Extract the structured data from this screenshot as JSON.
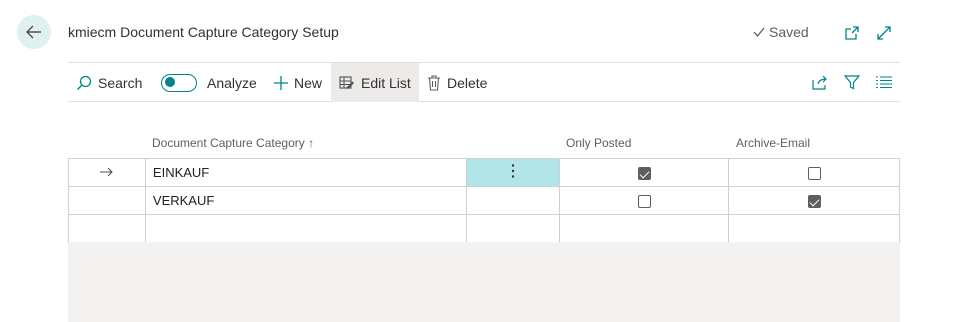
{
  "header": {
    "title": "kmiecm Document Capture Category Setup",
    "saved_label": "Saved"
  },
  "actions": {
    "search": "Search",
    "analyze": "Analyze",
    "new": "New",
    "edit_list": "Edit List",
    "delete": "Delete"
  },
  "columns": {
    "category": "Document Capture Category",
    "sort_indicator": "↑",
    "only_posted": "Only Posted",
    "archive_email": "Archive-Email"
  },
  "rows": [
    {
      "category": "EINKAUF",
      "only_posted": true,
      "archive_email": false,
      "current": true
    },
    {
      "category": "VERKAUF",
      "only_posted": false,
      "archive_email": true,
      "current": false
    }
  ],
  "colors": {
    "accent": "#008489",
    "selected_cell": "#b2e5e8",
    "back_button": "#dff0f1"
  }
}
